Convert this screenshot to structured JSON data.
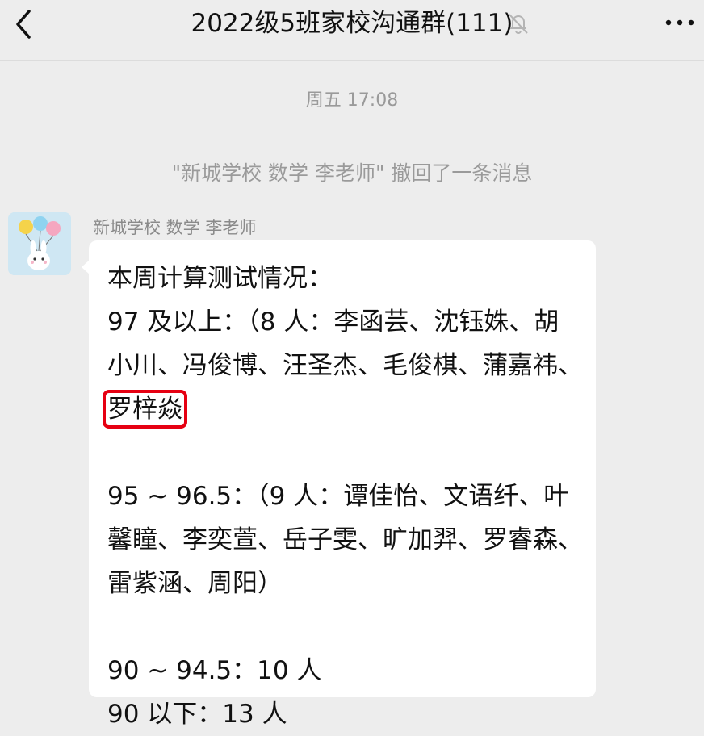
{
  "header": {
    "back_icon": "chevron-left-icon",
    "title": "2022级5班家校沟通群(111)",
    "mute_icon": "bell-off-icon",
    "more_icon": "more-dots-icon"
  },
  "chat": {
    "timestamp": "周五 17:08",
    "recall_notice": "\"新城学校 数学 李老师\" 撤回了一条消息",
    "message": {
      "sender": "新城学校 数学 李老师",
      "avatar": "cartoon-rabbit-with-balloons",
      "line1": "本周计算测试情况：",
      "group1_before_highlight": "97 及以上：（8 人：李函芸、沈钰姝、胡小川、冯俊博、汪圣杰、毛俊棋、蒲嘉祎、",
      "group1_highlighted_name": "罗梓焱",
      "group2": "95 ~ 96.5：（9 人：谭佳怡、文语纤、叶馨瞳、李奕萱、岳子雯、旷加羿、罗睿森、雷紫涵、周阳）",
      "group3": "90 ~ 94.5：10 人",
      "group4": "90 以下：13 人"
    }
  },
  "colors": {
    "background": "#ededed",
    "bubble": "#ffffff",
    "highlight_box": "#e60012",
    "meta_text": "#9a9a9a"
  }
}
